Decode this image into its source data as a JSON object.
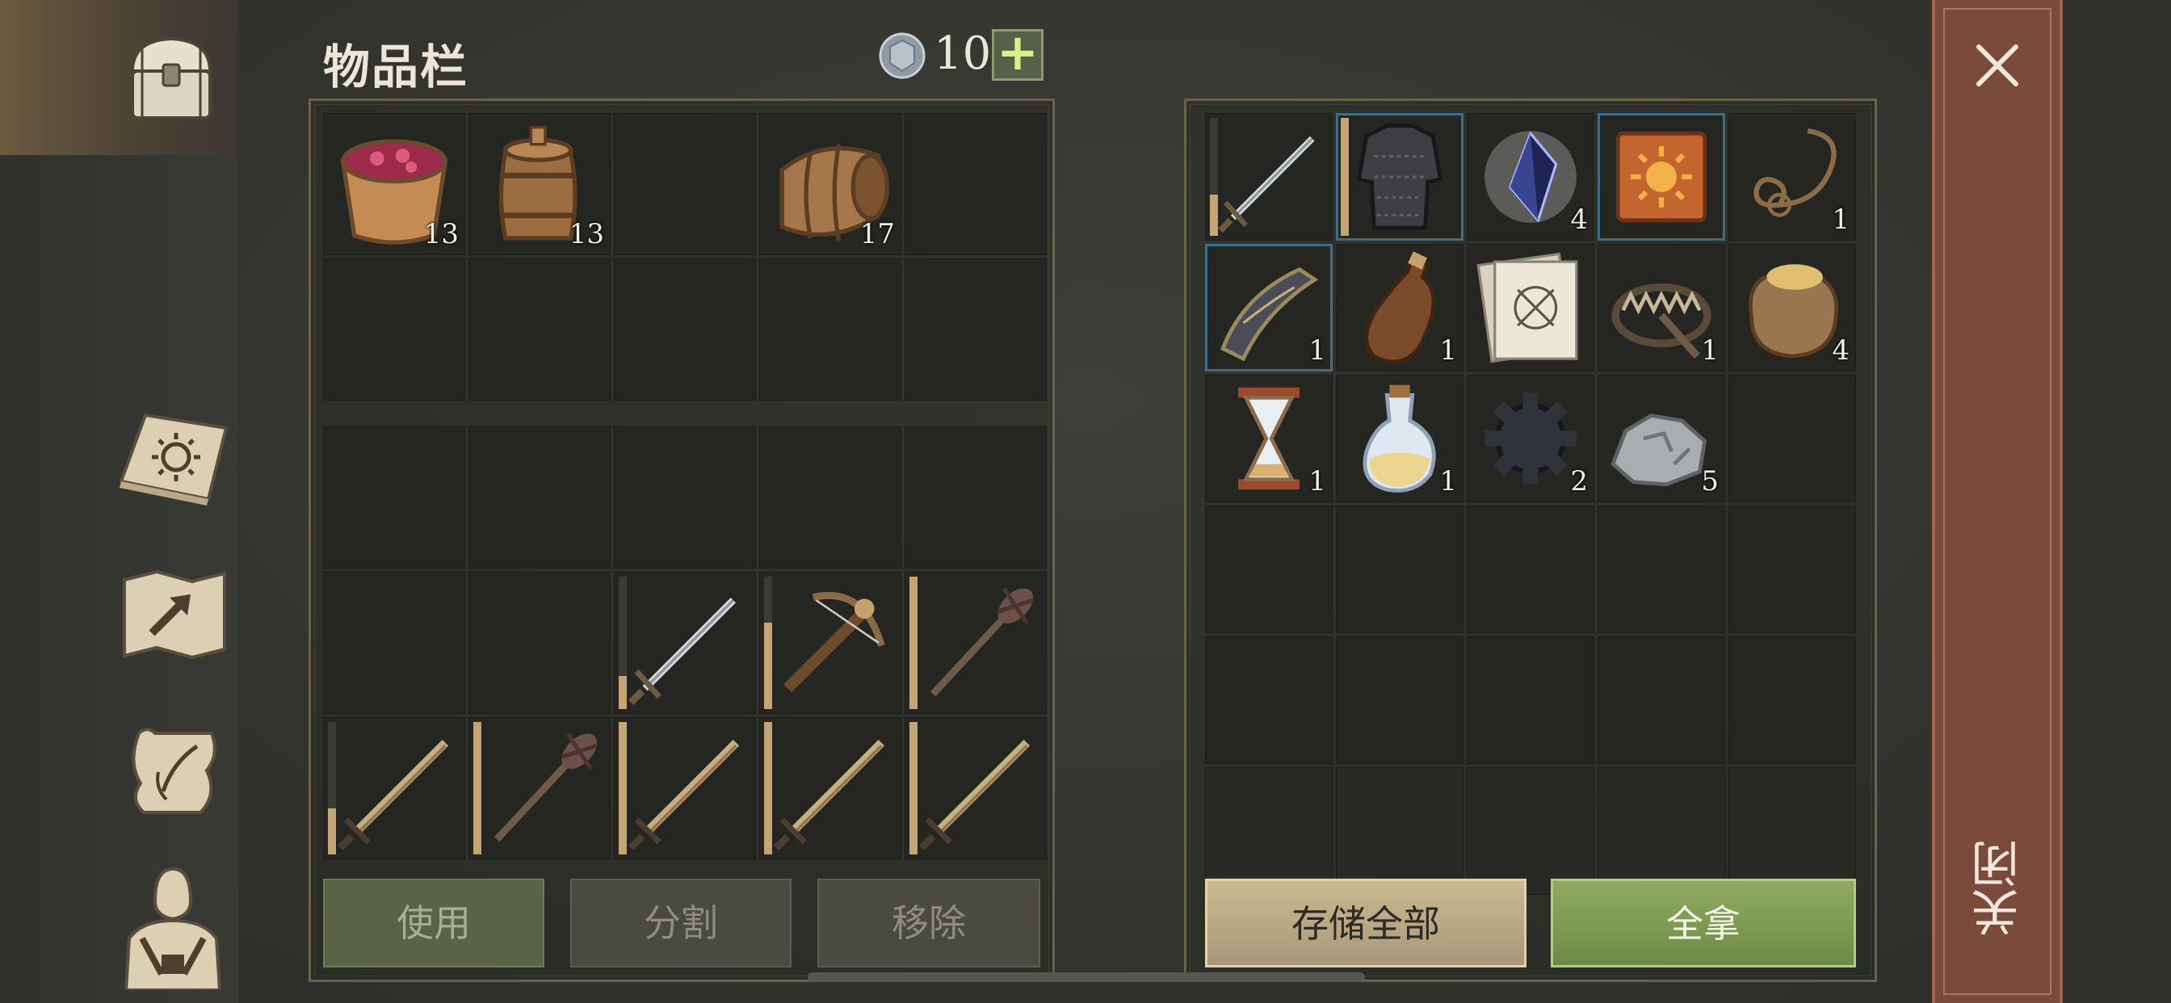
{
  "header": {
    "title": "物品栏",
    "coin_icon": "silver-coin-icon",
    "coin_count": "10",
    "add_label": "+"
  },
  "sidebar": {
    "tabs": [
      {
        "id": "chest",
        "icon": "chest-icon",
        "active": true
      },
      {
        "id": "book",
        "icon": "sun-book-icon"
      },
      {
        "id": "map",
        "icon": "map-icon"
      },
      {
        "id": "recipes",
        "icon": "scroll-icon"
      },
      {
        "id": "character",
        "icon": "character-icon"
      }
    ]
  },
  "inventory": {
    "top": [
      {
        "item": "berry-bucket",
        "count": "13"
      },
      {
        "item": "small-barrel",
        "count": "13"
      },
      {
        "item": ""
      },
      {
        "item": "large-barrel",
        "count": "17"
      },
      {
        "item": ""
      },
      {
        "item": ""
      },
      {
        "item": ""
      },
      {
        "item": ""
      },
      {
        "item": ""
      },
      {
        "item": ""
      }
    ],
    "bottom": [
      {
        "item": ""
      },
      {
        "item": ""
      },
      {
        "item": ""
      },
      {
        "item": ""
      },
      {
        "item": ""
      },
      {
        "item": ""
      },
      {
        "item": ""
      },
      {
        "item": "steel-sword",
        "durability": 0.25
      },
      {
        "item": "crossbow",
        "durability": 0.65
      },
      {
        "item": "mace",
        "durability": 1.0
      },
      {
        "item": "wooden-sword",
        "durability": 0.35
      },
      {
        "item": "mace",
        "durability": 1.0
      },
      {
        "item": "wooden-sword",
        "durability": 1.0
      },
      {
        "item": "wooden-sword",
        "durability": 1.0
      },
      {
        "item": "wooden-sword",
        "durability": 1.0
      }
    ]
  },
  "storage": {
    "slots": [
      {
        "item": "steel-sword",
        "durability": 0.35
      },
      {
        "item": "chainmail-armor",
        "durability": 1.0,
        "selected": true
      },
      {
        "item": "dark-crystal",
        "count": "4"
      },
      {
        "item": "sun-book",
        "selected": true
      },
      {
        "item": "rope",
        "count": "1"
      },
      {
        "item": "bow-part",
        "count": "1",
        "selected": true
      },
      {
        "item": "leather-flask",
        "count": "1"
      },
      {
        "item": "blueprint-papers"
      },
      {
        "item": "bear-trap",
        "count": "1"
      },
      {
        "item": "grain-sack",
        "count": "4"
      },
      {
        "item": "hourglass",
        "count": "1"
      },
      {
        "item": "potion",
        "count": "1"
      },
      {
        "item": "gear",
        "count": "2"
      },
      {
        "item": "iron-ore",
        "count": "5"
      },
      {
        "item": ""
      },
      {
        "item": ""
      },
      {
        "item": ""
      },
      {
        "item": ""
      },
      {
        "item": ""
      },
      {
        "item": ""
      },
      {
        "item": ""
      },
      {
        "item": ""
      },
      {
        "item": ""
      },
      {
        "item": ""
      },
      {
        "item": ""
      },
      {
        "item": "",
        "faded": true
      },
      {
        "item": "",
        "faded": true
      },
      {
        "item": "",
        "faded": true
      },
      {
        "item": "",
        "faded": true
      },
      {
        "item": "",
        "faded": true
      }
    ]
  },
  "buttons": {
    "use": "使用",
    "split": "分割",
    "remove": "移除",
    "store_all": "存储全部",
    "take_all": "全拿"
  },
  "close": {
    "label": "关闭",
    "icon": "close-icon"
  },
  "colors": {
    "durability": "#c5a574",
    "selected_border": "#3e6d8a",
    "take_all": "#7f9a52",
    "close_strip": "#7a4a3b"
  }
}
